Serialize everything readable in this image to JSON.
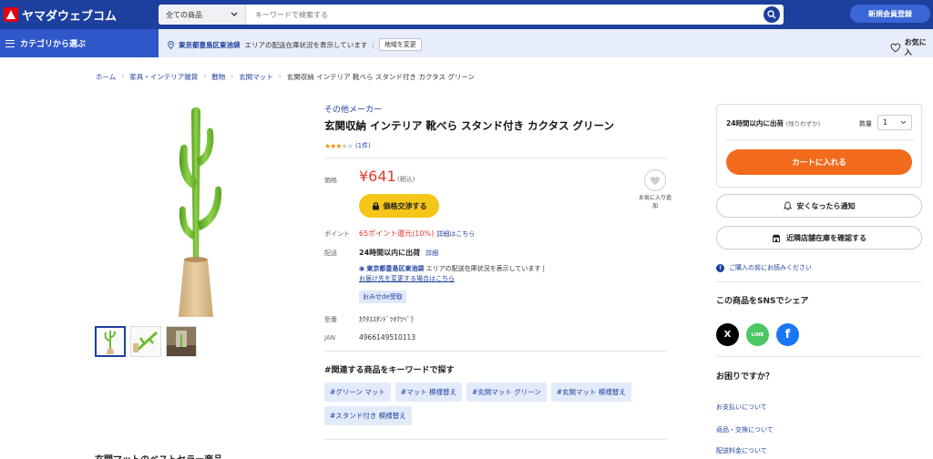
{
  "header": {
    "logo_text": "ヤマダウェブコム",
    "search_category": "全ての商品",
    "search_placeholder": "キーワードで検索する",
    "register_label": "新規会員登録"
  },
  "subbar": {
    "category_label": "カテゴリから選ぶ",
    "delivery_location": "東京都豊島区東池袋",
    "delivery_text": "エリアの配送在庫状況を表示しています",
    "change_region_label": "地域を変更",
    "favorites_label": "お気に入"
  },
  "breadcrumb": [
    "ホーム",
    "家具・インテリア雑貨",
    "敷物",
    "玄関マット",
    "玄関収納 インテリア 靴べら スタンド付き カクタス グリーン"
  ],
  "product": {
    "maker": "その他メーカー",
    "title": "玄関収納 インテリア 靴べら スタンド付き カクタス グリーン",
    "rating_stars": 3,
    "rating_max": 5,
    "review_count": "(1件)",
    "price_label": "価格",
    "price": "¥641",
    "tax_note": "(税込)",
    "nego_label": "価格交渉する",
    "favorite_label": "お気に入り追加",
    "point_label": "ポイント",
    "points_text": "65ポイント還元(10%)",
    "points_detail": "詳細はこちら",
    "shipping_label": "配送",
    "shipping_text": "24時間以内に出荷",
    "shipping_detail": "詳細",
    "ship_location": "東京都豊島区東池袋",
    "ship_location_text": "エリアの配送在庫状況を表示しています",
    "ship_change": "お届け先を変更する場合はこちら",
    "pickup_badge": "おみせde受取",
    "model_label": "型番",
    "model_value": "ｶｸﾀｽｽﾀﾝﾄﾞﾂｷｸﾂﾍﾞﾗ",
    "jan_label": "JAN",
    "jan_value": "4966149510113"
  },
  "keywords": {
    "title": "#関連する商品をキーワードで探す",
    "items": [
      "#グリーン マット",
      "#マット 模様替え",
      "#玄関マット グリーン",
      "#玄関マット 模様替え",
      "#スタンド付き 模様替え"
    ]
  },
  "bestseller_title": "玄関マットのベストセラー商品",
  "purchase": {
    "stock_text": "24時間以内に出荷",
    "stock_sub": "(残りわずか)",
    "qty_label": "数量",
    "qty_value": "1",
    "cart_label": "カートに入れる",
    "notify_label": "安くなったら通知",
    "store_stock_label": "近隣店舗在庫を確認する",
    "notice_label": "ご購入の前にお読みください"
  },
  "share": {
    "title": "この商品をSNSでシェア",
    "x_label": "X",
    "line_label": "LINE",
    "fb_label": "f"
  },
  "help": {
    "title": "お困りですか？",
    "links": [
      "お支払いについて",
      "返品・交換について",
      "配送料金について"
    ]
  },
  "colors": {
    "brand_blue": "#1d3f9e",
    "price_red": "#e23d2e",
    "cart_orange": "#f26b1d",
    "nego_yellow": "#f5c518"
  }
}
